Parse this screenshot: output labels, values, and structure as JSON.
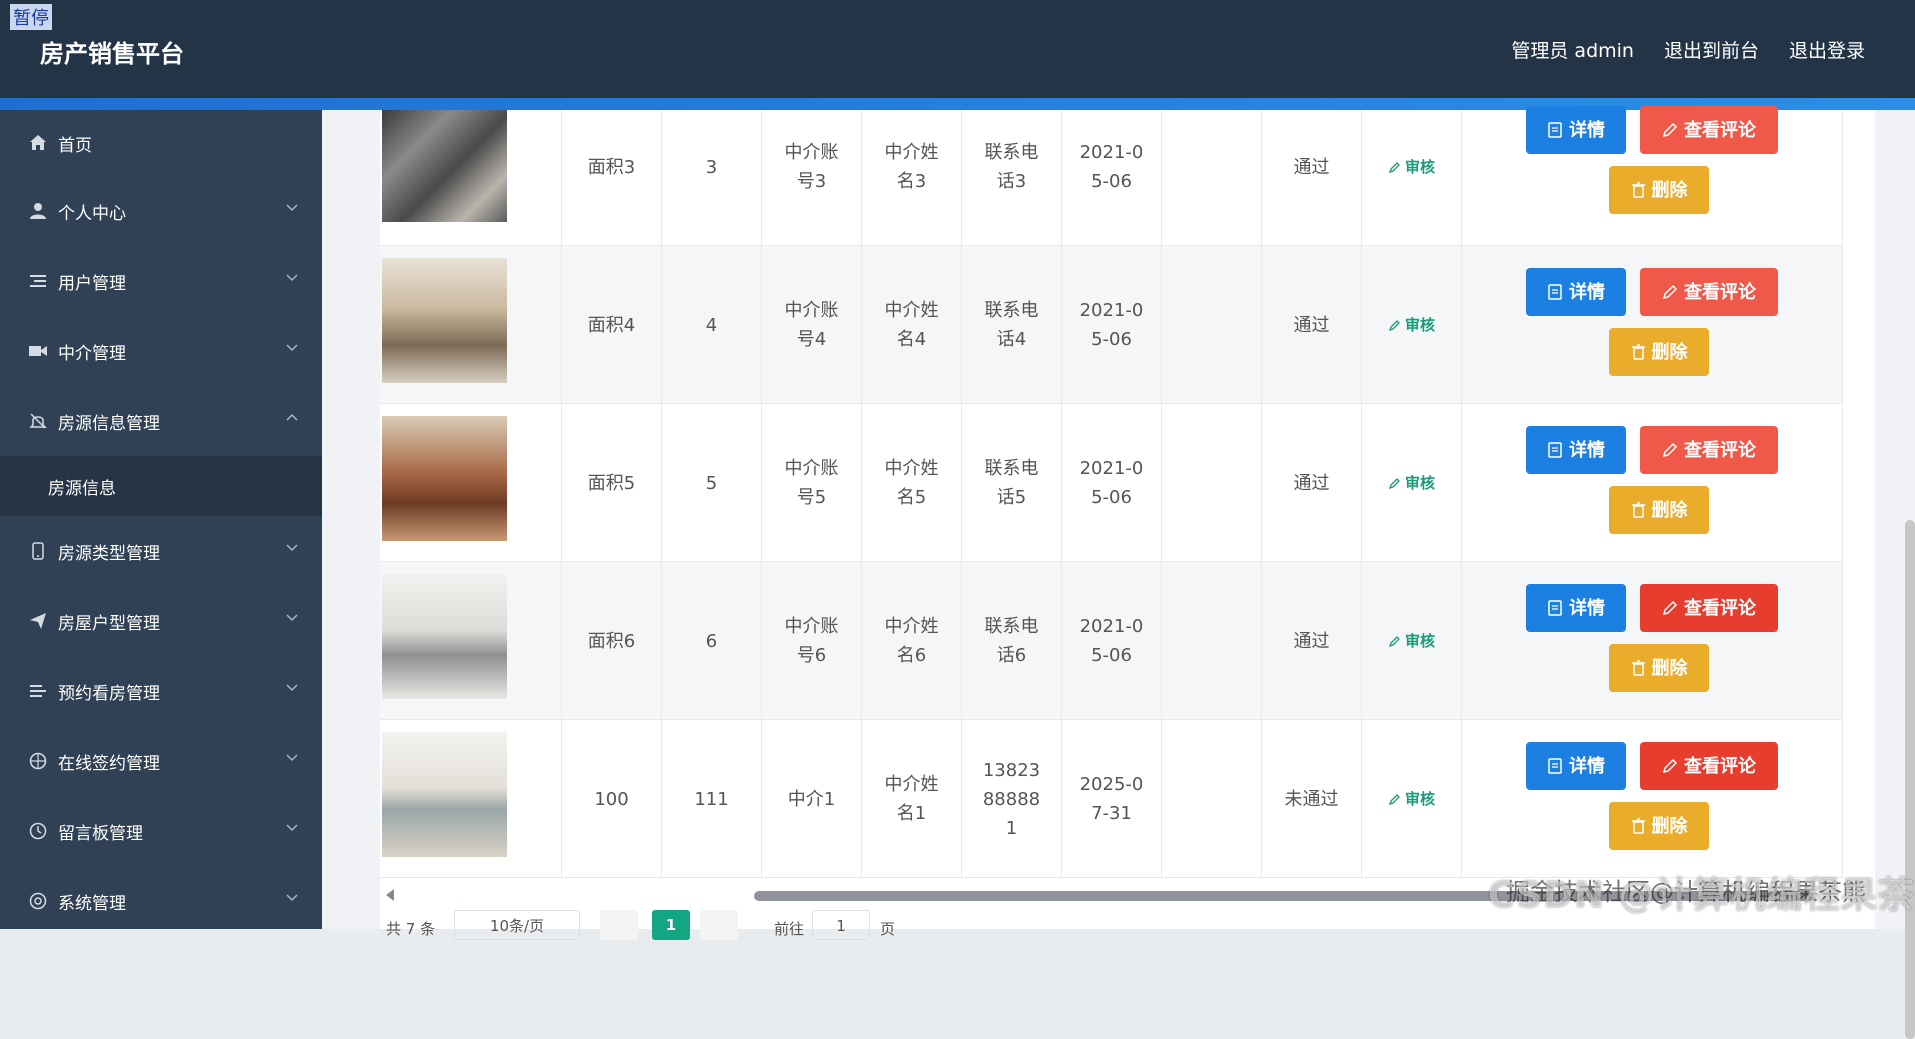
{
  "overlay": {
    "pause_label": "暂停"
  },
  "header": {
    "title": "房产销售平台",
    "links": [
      "管理员 admin",
      "退出到前台",
      "退出登录"
    ]
  },
  "sidebar": {
    "items": [
      {
        "label": "首页",
        "icon": "home-icon"
      },
      {
        "label": "个人中心",
        "icon": "user-icon"
      },
      {
        "label": "用户管理",
        "icon": "list-icon"
      },
      {
        "label": "中介管理",
        "icon": "video-camera-icon"
      },
      {
        "label": "房源信息管理",
        "icon": "bell-off-icon"
      },
      {
        "label": "房源信息",
        "icon": ""
      },
      {
        "label": "房源类型管理",
        "icon": "phone-icon"
      },
      {
        "label": "房屋户型管理",
        "icon": "send-icon"
      },
      {
        "label": "预约看房管理",
        "icon": "list-icon"
      },
      {
        "label": "在线签约管理",
        "icon": "compass-icon"
      },
      {
        "label": "留言板管理",
        "icon": "clock-icon"
      },
      {
        "label": "系统管理",
        "icon": "settings-icon"
      }
    ]
  },
  "table": {
    "rows": [
      {
        "area": "面积3",
        "num": "3",
        "agent_account": "中介账号3",
        "agent_name": "中介姓名3",
        "phone": "联系电话3",
        "date": "2021-05-06",
        "status": "通过",
        "audit": "审核",
        "image": "loft-stairs"
      },
      {
        "area": "面积4",
        "num": "4",
        "agent_account": "中介账号4",
        "agent_name": "中介姓名4",
        "phone": "联系电话4",
        "date": "2021-05-06",
        "status": "通过",
        "audit": "审核",
        "image": "living-room-chandelier"
      },
      {
        "area": "面积5",
        "num": "5",
        "agent_account": "中介账号5",
        "agent_name": "中介姓名5",
        "phone": "联系电话5",
        "date": "2021-05-06",
        "status": "通过",
        "audit": "审核",
        "image": "living-room-wood"
      },
      {
        "area": "面积6",
        "num": "6",
        "agent_account": "中介账号6",
        "agent_name": "中介姓名6",
        "phone": "联系电话6",
        "date": "2021-05-06",
        "status": "通过",
        "audit": "审核",
        "image": "living-room-grey"
      },
      {
        "area": "100",
        "num": "111",
        "agent_account": "中介1",
        "agent_name": "中介姓名1",
        "phone": "13823888881",
        "date": "2025-07-31",
        "status": "未通过",
        "audit": "审核",
        "image": "living-room-white"
      }
    ],
    "actions": {
      "detail": "详情",
      "comment": "查看评论",
      "delete": "删除"
    }
  },
  "pager": {
    "total": "共 7 条",
    "page_size": "10条/页",
    "current": "1",
    "goto_label": "前往",
    "goto_value": "1",
    "page_suffix": "页"
  },
  "watermark": "CSDN @计算机编程果茶熊",
  "watermark_overlay": "掘金技术社区@计算机编程果茶熊",
  "colors": {
    "header_bg": "#243447",
    "sidebar_bg": "#304156",
    "detail_btn": "#1b80e2",
    "comment_btn": "#f0594a",
    "delete_btn": "#e9ad2b",
    "audit_link": "#1a9b7a",
    "pager_active": "#13a683"
  }
}
